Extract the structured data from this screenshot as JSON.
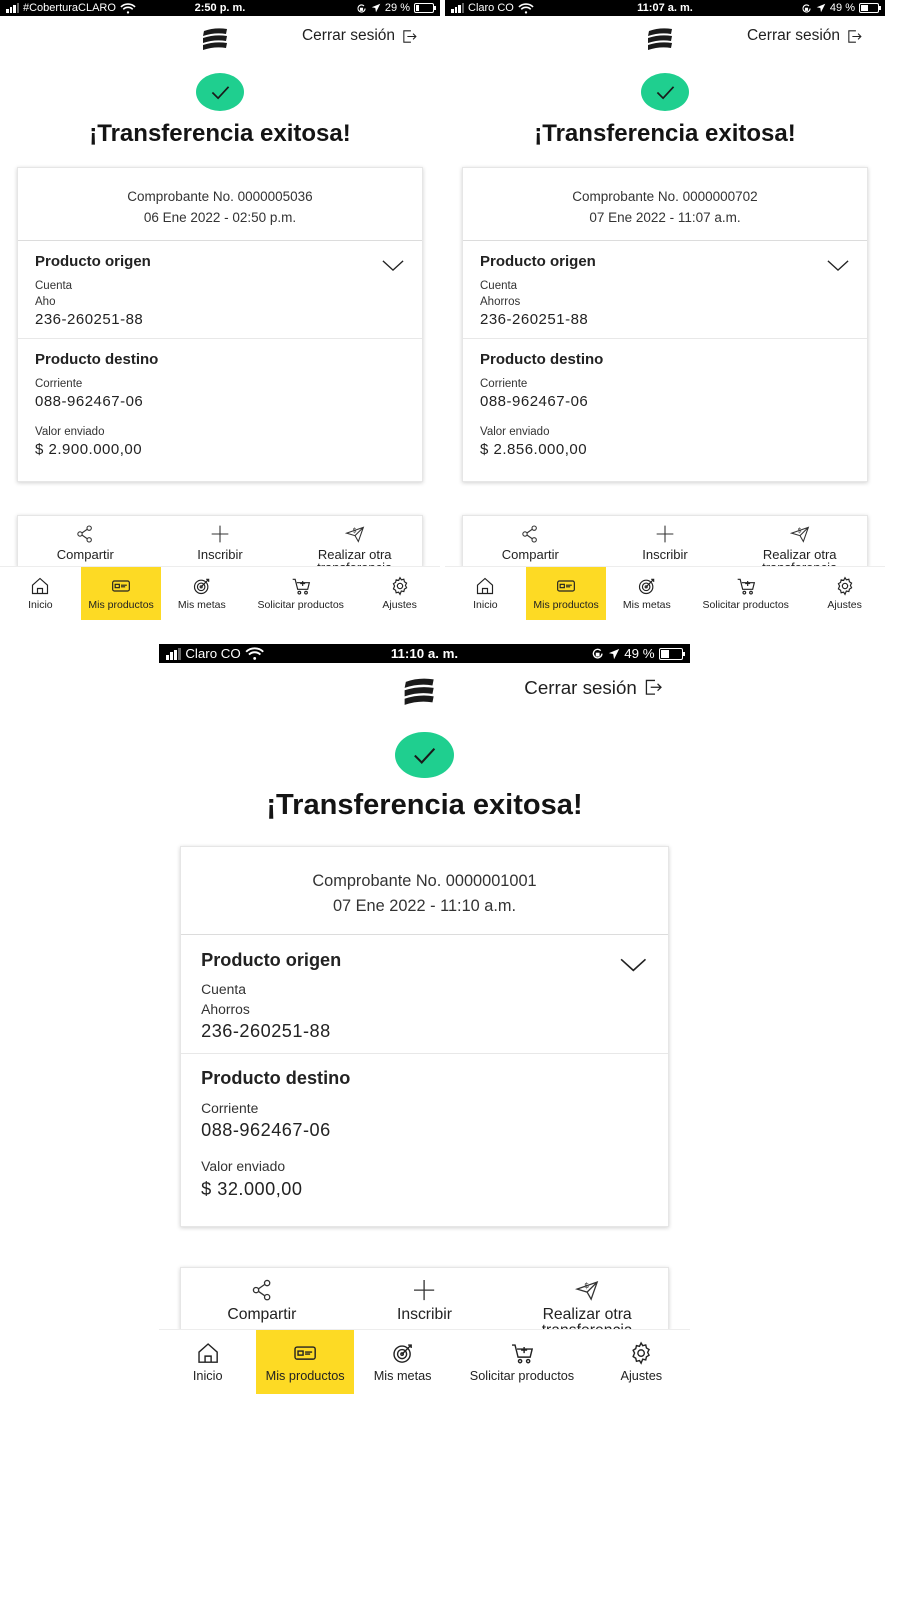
{
  "screens": [
    {
      "status": {
        "carrier": "#CoberturaCLARO",
        "time": "2:50 p. m.",
        "battery": "29 %",
        "battery_level": 0.29
      },
      "logout_label": "Cerrar sesión",
      "title": "¡Transferencia exitosa!",
      "receipt": {
        "number": "Comprobante No. 0000005036",
        "date": "06 Ene 2022 - 02:50 p.m."
      },
      "origin": {
        "title": "Producto origen",
        "line1": "Cuenta",
        "line2": "Aho",
        "account": "236-260251-88"
      },
      "destination": {
        "title": "Producto destino",
        "type": "Corriente",
        "account": "088-962467-06"
      },
      "amount": {
        "label": "Valor enviado",
        "value": "$ 2.900.000,00"
      }
    },
    {
      "status": {
        "carrier": "Claro CO",
        "time": "11:07 a. m.",
        "battery": "49 %",
        "battery_level": 0.49
      },
      "logout_label": "Cerrar sesión",
      "title": "¡Transferencia exitosa!",
      "receipt": {
        "number": "Comprobante No. 0000000702",
        "date": "07 Ene 2022 - 11:07 a.m."
      },
      "origin": {
        "title": "Producto origen",
        "line1": "Cuenta",
        "line2": "Ahorros",
        "account": "236-260251-88"
      },
      "destination": {
        "title": "Producto destino",
        "type": "Corriente",
        "account": "088-962467-06"
      },
      "amount": {
        "label": "Valor enviado",
        "value": "$ 2.856.000,00"
      }
    },
    {
      "status": {
        "carrier": "Claro CO",
        "time": "11:10 a. m.",
        "battery": "49 %",
        "battery_level": 0.49
      },
      "logout_label": "Cerrar sesión",
      "title": "¡Transferencia exitosa!",
      "receipt": {
        "number": "Comprobante No. 0000001001",
        "date": "07 Ene 2022 - 11:10 a.m."
      },
      "origin": {
        "title": "Producto origen",
        "line1": "Cuenta",
        "line2": "Ahorros",
        "account": "236-260251-88"
      },
      "destination": {
        "title": "Producto destino",
        "type": "Corriente",
        "account": "088-962467-06"
      },
      "amount": {
        "label": "Valor enviado",
        "value": "$ 32.000,00"
      }
    }
  ],
  "actions": [
    {
      "label": "Compartir",
      "icon": "share-icon"
    },
    {
      "label": "Inscribir",
      "icon": "plus-icon"
    },
    {
      "label": "Realizar otra transferencia",
      "icon": "send-money-icon"
    }
  ],
  "nav": [
    {
      "label": "Inicio",
      "icon": "home-icon"
    },
    {
      "label": "Mis productos",
      "icon": "card-icon",
      "active": true
    },
    {
      "label": "Mis metas",
      "icon": "target-icon"
    },
    {
      "label": "Solicitar productos",
      "icon": "cart-plus-icon"
    },
    {
      "label": "Ajustes",
      "icon": "gear-icon"
    }
  ],
  "colors": {
    "success": "#1fcf8f",
    "nav_active": "#fdda24",
    "status_bar": "#000000"
  }
}
